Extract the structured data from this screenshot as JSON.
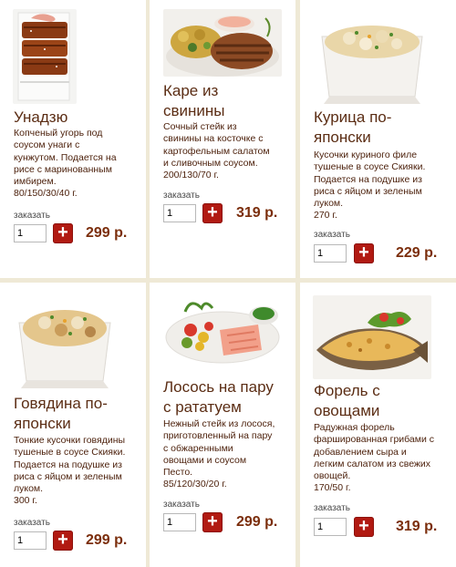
{
  "order_label": "заказать",
  "add_icon": "plus-icon",
  "colors": {
    "background": "#efe9d6",
    "card": "#ffffff",
    "title": "#5b2d14",
    "price": "#7b2e0c",
    "button": "#b11a12"
  },
  "items": [
    {
      "title_lines": [
        "Унадзю"
      ],
      "description": [
        "Копченый угорь под",
        "соусом унаги с",
        "кунжутом. Подается на",
        "рисе с маринованным",
        "имбирем."
      ],
      "weight": "80/150/30/40 г.",
      "quantity": "1",
      "price": "299 р."
    },
    {
      "title_lines": [
        "Каре из",
        "свинины"
      ],
      "description": [
        "Сочный стейк из",
        "свинины на косточке с",
        "картофельным салатом",
        "и сливочным соусом."
      ],
      "weight": "200/130/70 г.",
      "quantity": "1",
      "price": "319 р."
    },
    {
      "title_lines": [
        "Курица по-",
        "японски"
      ],
      "description": [
        "Кусочки куриного филе",
        "тушеные в соусе Скияки.",
        "Подается на подушке из",
        "риса с яйцом и зеленым",
        "луком."
      ],
      "weight": "270 г.",
      "quantity": "1",
      "price": "229 р."
    },
    {
      "title_lines": [
        "Говядина по-",
        "японски"
      ],
      "description": [
        "Тонкие кусочки говядины",
        "тушеные в соусе Скияки.",
        "Подается на подушке из",
        "риса с яйцом и зеленым",
        "луком."
      ],
      "weight": "300 г.",
      "quantity": "1",
      "price": "299 р."
    },
    {
      "title_lines": [
        "Лосось на пару",
        "с рататуем"
      ],
      "description": [
        "Нежный стейк из лосося,",
        "приготовленный на пару",
        "с обжаренными",
        "овощами и соусом",
        "Песто."
      ],
      "weight": "85/120/30/20 г.",
      "quantity": "1",
      "price": "299 р."
    },
    {
      "title_lines": [
        "Форель с",
        "овощами"
      ],
      "description": [
        "Радужная форель",
        "фаршированная грибами с",
        "добавлением сыра и",
        "легким салатом из свежих",
        "овощей."
      ],
      "weight": "170/50 г.",
      "quantity": "1",
      "price": "319 р."
    }
  ]
}
